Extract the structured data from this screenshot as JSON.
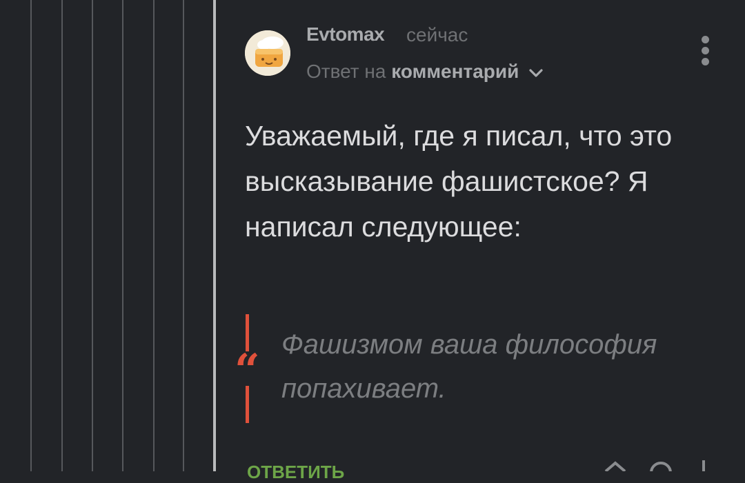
{
  "comment": {
    "author": "Evtomax",
    "time": "сейчас",
    "reply_prefix": "Ответ на",
    "reply_target": "комментарий",
    "body": "Уважаемый, где я писал, что это высказывание фашистское? Я написал следующее:",
    "quote": "Фашизмом ваша философия попахивает.",
    "reply_button": "ОТВЕТИТЬ"
  },
  "colors": {
    "background": "#222428",
    "quote_accent": "#e0513b",
    "reply_button": "#6da548"
  },
  "icons": [
    "more-vertical-icon",
    "chevron-down-icon",
    "cake-avatar",
    "quote-icon"
  ]
}
